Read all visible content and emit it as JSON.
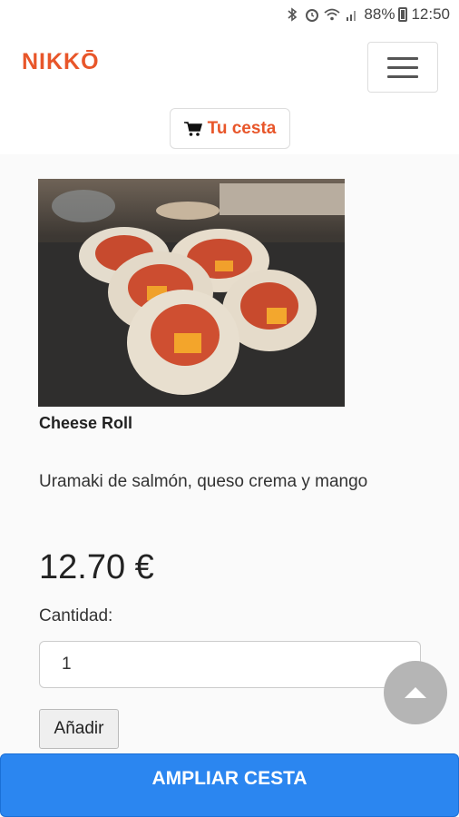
{
  "status_bar": {
    "icons": [
      "bluetooth-icon",
      "alarm-icon",
      "wifi-icon",
      "signal-icon"
    ],
    "battery": "88%",
    "time": "12:50"
  },
  "header": {
    "brand": "NIKKŌ",
    "menu_icon": "hamburger-menu-icon",
    "cart_icon": "shopping-cart-icon",
    "cart_label": "Tu cesta"
  },
  "product": {
    "name": "Cheese Roll",
    "description": "Uramaki de salmón, queso crema y mango",
    "price": "12.70 €",
    "quantity_label": "Cantidad:",
    "quantity_value": "1",
    "add_label": "Añadir"
  },
  "footer": {
    "scroll_top_icon": "arrow-up-icon",
    "expand_cart_label": "AMPLIAR CESTA"
  },
  "colors": {
    "brand": "#e8562a",
    "primary_button": "#2b86f0",
    "scroll_button": "#b5b5b5"
  }
}
